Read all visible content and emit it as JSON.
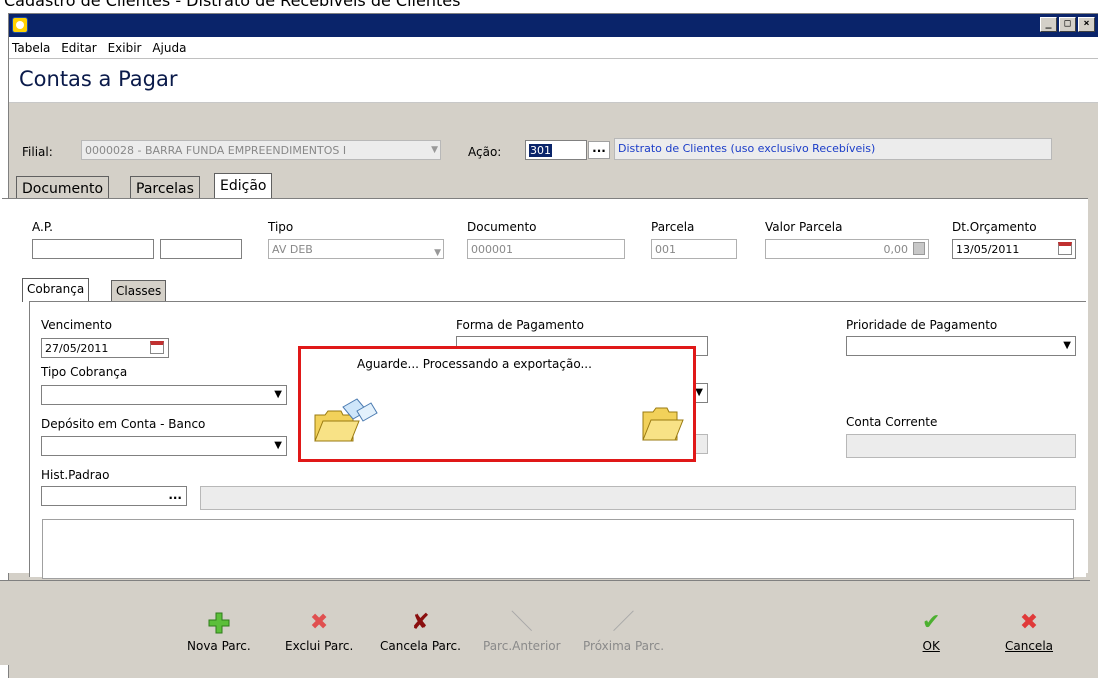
{
  "window": {
    "caption": "Cadastro de Clientes - Distrato de Recebíveis de Clientes",
    "controls": {
      "minimize": "_",
      "maximize": "□",
      "close": "×"
    }
  },
  "menu": [
    "Tabela",
    "Editar",
    "Exibir",
    "Ajuda"
  ],
  "header": {
    "title": "Contas a Pagar"
  },
  "filial": {
    "label": "Filial:",
    "value": "0000028 - BARRA FUNDA EMPREENDIMENTOS I"
  },
  "acao": {
    "label": "Ação:",
    "code": "301",
    "dots": "...",
    "description": "Distrato de Clientes (uso exclusivo Recebíveis)"
  },
  "tabs": [
    "Documento",
    "Parcelas",
    "Edição"
  ],
  "edit": {
    "ap_label": "A.P.",
    "tipo_label": "Tipo",
    "tipo_value": "AV DEB",
    "documento_label": "Documento",
    "documento_value": "000001",
    "parcela_label": "Parcela",
    "parcela_value": "001",
    "valor_label": "Valor Parcela",
    "valor_value": "0,00",
    "dt_label": "Dt.Orçamento",
    "dt_value": "13/05/2011"
  },
  "subtabs": [
    "Cobrança",
    "Classes"
  ],
  "cobranca": {
    "vencimento_label": "Vencimento",
    "vencimento_value": "27/05/2011",
    "forma_label": "Forma de Pagamento",
    "prioridade_label": "Prioridade de Pagamento",
    "tipo_cobranca_label": "Tipo Cobrança",
    "deposito_label": "Depósito em Conta - Banco",
    "conta_label": "Conta Corrente",
    "hist_label": "Hist.Padrao",
    "hist_dots": "..."
  },
  "dialog": {
    "message": "Aguarde... Processando a exportação..."
  },
  "toolbar": {
    "nova": "Nova Parc.",
    "exclui": "Exclui Parc.",
    "cancela_parc": "Cancela Parc.",
    "anterior": "Parc.Anterior",
    "proxima": "Próxima Parc.",
    "ok": "OK",
    "cancela": "Cancela"
  },
  "colors": {
    "titlebar": "#0a246a",
    "dialog_border": "#e01818",
    "accent_link": "#1a3cc8"
  }
}
